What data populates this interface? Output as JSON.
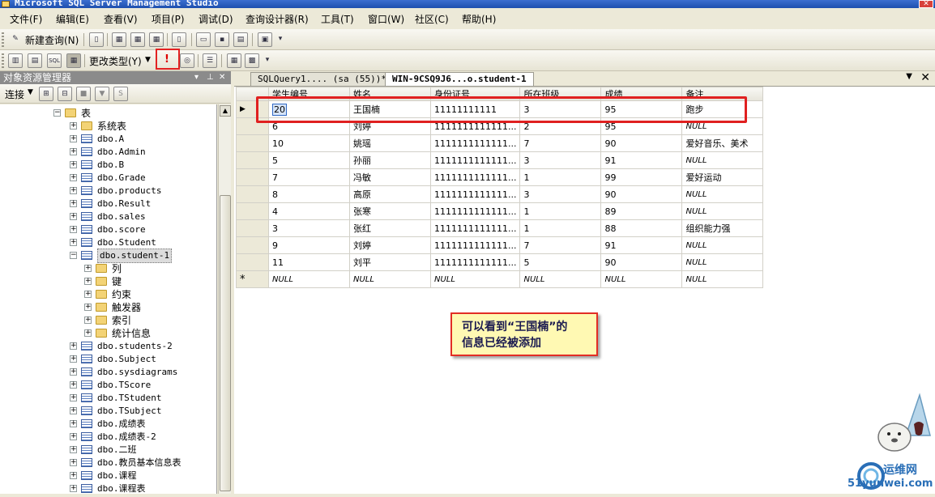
{
  "window": {
    "title": "Microsoft SQL Server Management Studio"
  },
  "menu": [
    "文件(F)",
    "编辑(E)",
    "查看(V)",
    "项目(P)",
    "调试(D)",
    "查询设计器(R)",
    "工具(T)",
    "窗口(W)",
    "社区(C)",
    "帮助(H)"
  ],
  "toolbar1": {
    "new_query_label": "新建查询(N)"
  },
  "toolbar2": {
    "change_type_label": "更改类型(Y)",
    "exec_glyph": "!"
  },
  "object_explorer": {
    "title": "对象资源管理器",
    "connect_label": "连接",
    "tree": [
      {
        "label": "表",
        "icon": "folder-icon",
        "expanded": true
      },
      {
        "label": "系统表",
        "icon": "folder-icon"
      },
      {
        "label": "dbo.A",
        "icon": "table-icon"
      },
      {
        "label": "dbo.Admin",
        "icon": "table-icon"
      },
      {
        "label": "dbo.B",
        "icon": "table-icon"
      },
      {
        "label": "dbo.Grade",
        "icon": "table-icon"
      },
      {
        "label": "dbo.products",
        "icon": "table-icon"
      },
      {
        "label": "dbo.Result",
        "icon": "table-icon"
      },
      {
        "label": "dbo.sales",
        "icon": "table-icon"
      },
      {
        "label": "dbo.score",
        "icon": "table-icon"
      },
      {
        "label": "dbo.Student",
        "icon": "table-icon"
      },
      {
        "label": "dbo.student-1",
        "icon": "table-icon",
        "expanded": true,
        "selected": true
      },
      {
        "label": "列",
        "icon": "folder-icon"
      },
      {
        "label": "键",
        "icon": "folder-icon"
      },
      {
        "label": "约束",
        "icon": "folder-icon"
      },
      {
        "label": "触发器",
        "icon": "folder-icon"
      },
      {
        "label": "索引",
        "icon": "folder-icon"
      },
      {
        "label": "统计信息",
        "icon": "folder-icon"
      },
      {
        "label": "dbo.students-2",
        "icon": "table-icon"
      },
      {
        "label": "dbo.Subject",
        "icon": "table-icon"
      },
      {
        "label": "dbo.sysdiagrams",
        "icon": "table-icon"
      },
      {
        "label": "dbo.TScore",
        "icon": "table-icon"
      },
      {
        "label": "dbo.TStudent",
        "icon": "table-icon"
      },
      {
        "label": "dbo.TSubject",
        "icon": "table-icon"
      },
      {
        "label": "dbo.成绩表",
        "icon": "table-icon"
      },
      {
        "label": "dbo.成绩表-2",
        "icon": "table-icon"
      },
      {
        "label": "dbo.二班",
        "icon": "table-icon"
      },
      {
        "label": "dbo.教员基本信息表",
        "icon": "table-icon"
      },
      {
        "label": "dbo.课程",
        "icon": "table-icon"
      },
      {
        "label": "dbo.课程表",
        "icon": "table-icon"
      }
    ]
  },
  "tabs": [
    {
      "label": "SQLQuery1.... (sa (55))*",
      "active": false
    },
    {
      "label": "WIN-9CSQ9J6...o.student-1",
      "active": true
    }
  ],
  "grid": {
    "columns": [
      "学生编号",
      "姓名",
      "身份证号",
      "所在班级",
      "成绩",
      "备注"
    ],
    "rows": [
      [
        "20",
        "王国楠",
        "11111111111",
        "3",
        "95",
        "跑步"
      ],
      [
        "6",
        "刘婷",
        "1111111111111...",
        "2",
        "95",
        "NULL"
      ],
      [
        "10",
        "姚瑶",
        "1111111111111...",
        "7",
        "90",
        "爱好音乐、美术"
      ],
      [
        "5",
        "孙丽",
        "1111111111111...",
        "3",
        "91",
        "NULL"
      ],
      [
        "7",
        "冯敏",
        "1111111111111...",
        "1",
        "99",
        "爱好运动"
      ],
      [
        "8",
        "高原",
        "1111111111111...",
        "3",
        "90",
        "NULL"
      ],
      [
        "4",
        "张寒",
        "1111111111111...",
        "1",
        "89",
        "NULL"
      ],
      [
        "3",
        "张红",
        "1111111111111...",
        "1",
        "88",
        "组织能力强"
      ],
      [
        "9",
        "刘婷",
        "1111111111111...",
        "7",
        "91",
        "NULL"
      ],
      [
        "11",
        "刘平",
        "1111111111111...",
        "5",
        "90",
        "NULL"
      ]
    ],
    "new_row": [
      "NULL",
      "NULL",
      "NULL",
      "NULL",
      "NULL",
      "NULL"
    ],
    "current_row_marker": "▶",
    "new_row_marker": "*"
  },
  "callout": {
    "line1": "可以看到“王国楠”的",
    "line2": "信息已经被添加"
  },
  "watermark": {
    "brand": "运维网",
    "site": "51yunwei.com"
  }
}
